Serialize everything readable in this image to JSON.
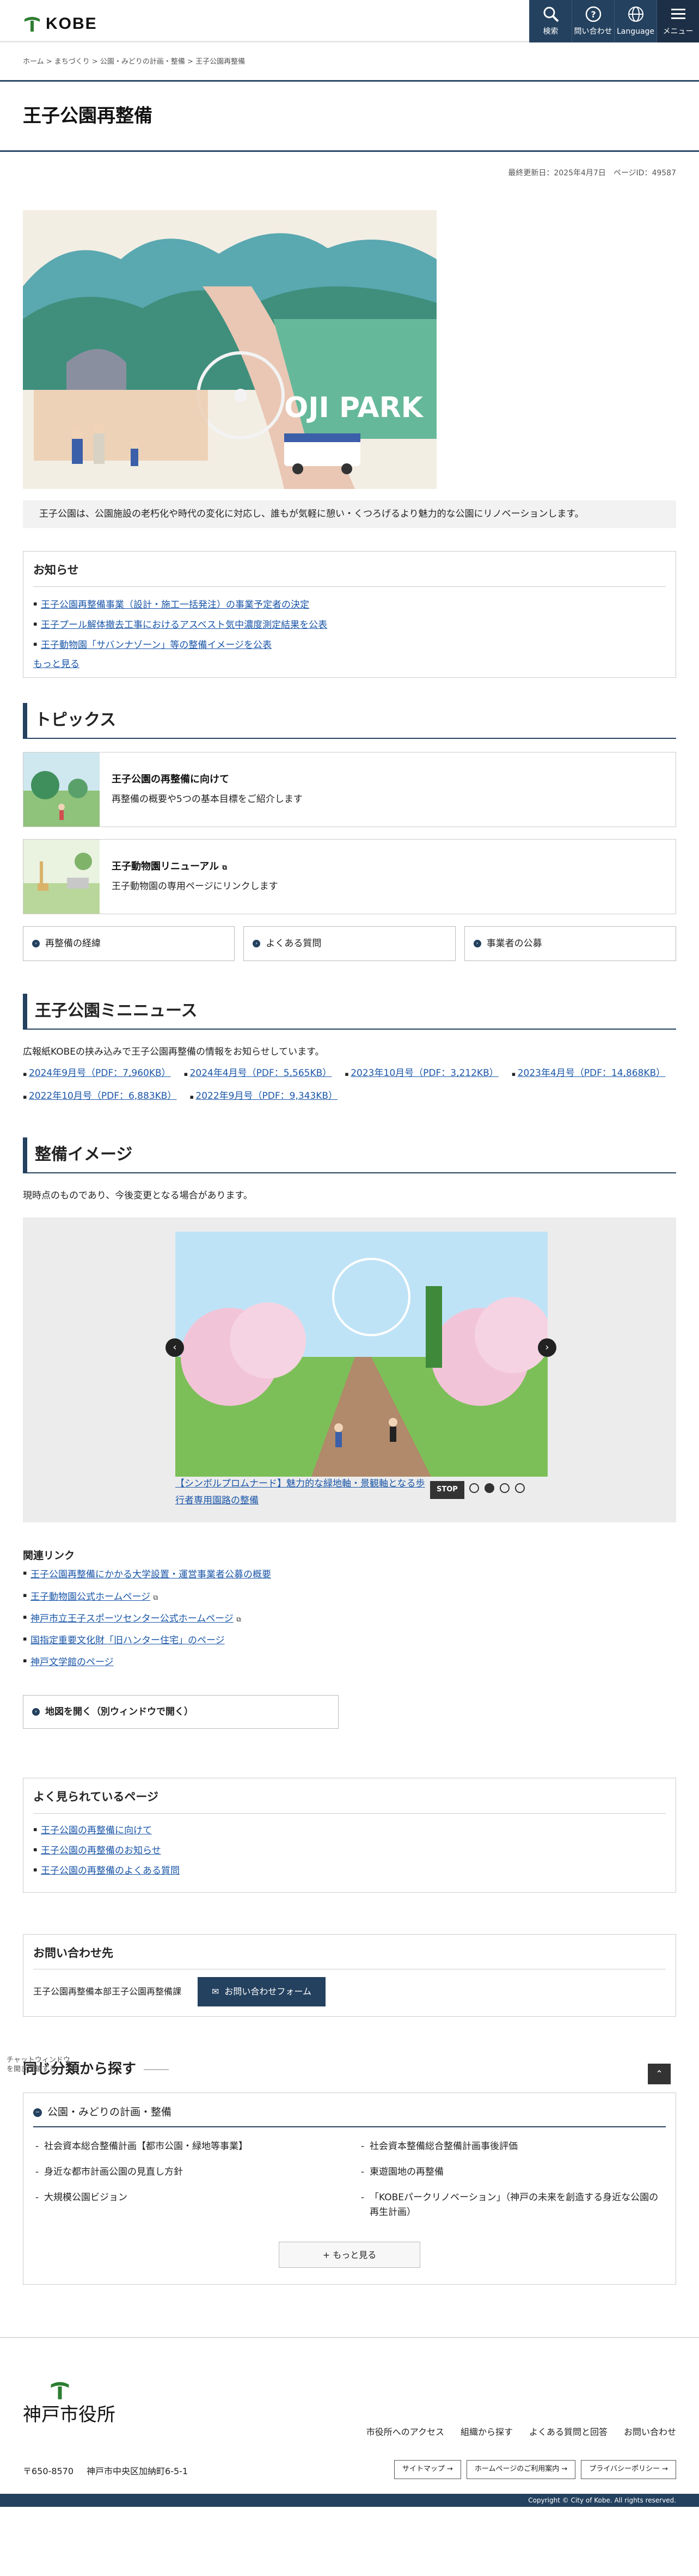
{
  "header": {
    "logo_text": "KOBE",
    "buttons": [
      {
        "label": "検索",
        "icon": "search-icon"
      },
      {
        "label": "問い合わせ",
        "icon": "question-icon"
      },
      {
        "label": "Language",
        "icon": "globe-icon"
      },
      {
        "label": "メニュー",
        "icon": "menu-icon"
      }
    ]
  },
  "breadcrumb": "ホーム > まちづくり > 公園・みどりの計画・整備 > 王子公園再整備",
  "page_title": "王子公園再整備",
  "updated": "最終更新日：2025年4月7日　ページID：49587",
  "hero_caption": "王子公園は、公園施設の老朽化や時代の変化に対応し、誰もが気軽に憩い・くつろげるより魅力的な公園にリノベーションします。",
  "hero_image_text": "OJI PARK",
  "notice": {
    "title": "お知らせ",
    "items": [
      "王子公園再整備事業（設計・施工一括発注）の事業予定者の決定",
      "王子プール解体撤去工事におけるアスベスト気中濃度測定結果を公表",
      "王子動物園「サバンナゾーン」等の整備イメージを公表"
    ],
    "more": "もっと見る"
  },
  "topics": {
    "heading": "トピックス",
    "items": [
      {
        "title": "王子公園の再整備に向けて",
        "desc": "再整備の概要や5つの基本目標をご紹介します"
      },
      {
        "title": "王子動物園リニューアル",
        "desc": "王子動物園の専用ページにリンクします"
      }
    ],
    "buttons": [
      "再整備の経緯",
      "よくある質問",
      "事業者の公募"
    ]
  },
  "mini_news": {
    "heading": "王子公園ミニニュース",
    "text": "広報紙KOBEの挟み込みで王子公園再整備の情報をお知らせしています。",
    "links": [
      "2024年9月号（PDF：7,960KB）",
      "2024年4月号（PDF：5,565KB）",
      "2023年10月号（PDF：3,212KB）",
      "2023年4月号（PDF：14,868KB）",
      "2022年10月号（PDF：6,883KB）",
      "2022年9月号（PDF：9,343KB）"
    ]
  },
  "images": {
    "heading": "整備イメージ",
    "text": "現時点のものであり、今後変更となる場合があります。",
    "caption": "【シンボルプロムナード】魅力的な緑地軸・景観軸となる歩行者専用園路の整備",
    "stop": "STOP",
    "prev": "‹",
    "next": "›"
  },
  "related": {
    "heading": "関連リンク",
    "items": [
      "王子公園再整備にかかる大学設置・運営事業者公募の概要",
      "王子動物園公式ホームページ",
      "神戸市立王子スポーツセンター公式ホームページ",
      "国指定重要文化財「旧ハンター住宅」のページ",
      "神戸文学館のページ"
    ],
    "external_mark": "⧉"
  },
  "map_button": "地図を開く（別ウィンドウで開く）",
  "popular": {
    "heading": "よく見られているページ",
    "items": [
      "王子公園の再整備に向けて",
      "王子公園の再整備のお知らせ",
      "王子公園の再整備のよくある質問"
    ]
  },
  "contact": {
    "heading": "お問い合わせ先",
    "dept": "王子公園再整備本部王子公園再整備課",
    "button": "お問い合わせフォーム"
  },
  "chat": "チャットウィンドウ\nを開き閉鎖する",
  "pagetop": "⌃",
  "category": {
    "heading": "同じ分類から探す",
    "title": "公園・みどりの計画・整備",
    "items": [
      "社会資本総合整備計画【都市公園・緑地等事業】",
      "社会資本整備総合整備計画事後評価",
      "身近な都市計画公園の見直し方針",
      "東遊園地の再整備",
      "大規模公園ビジョン",
      "「KOBEパークリノベーション」（神戸の未来を創造する身近な公園の再生計画）"
    ],
    "more": "+ もっと見る"
  },
  "footer": {
    "name": "神戸市役所",
    "nav": [
      "市役所へのアクセス",
      "組織から探す",
      "よくある質問と回答",
      "お問い合わせ"
    ],
    "postal": "〒650-8570",
    "address": "神戸市中央区加納町6-5-1",
    "buttons": [
      "サイトマップ →",
      "ホームページのご利用案内 →",
      "プライバシーポリシー →"
    ],
    "copyright": "Copyright © City of Kobe. All rights reserved."
  },
  "colors": {
    "brand": "#24415f",
    "link": "#1a56a8",
    "accent": "#2e7d32"
  }
}
